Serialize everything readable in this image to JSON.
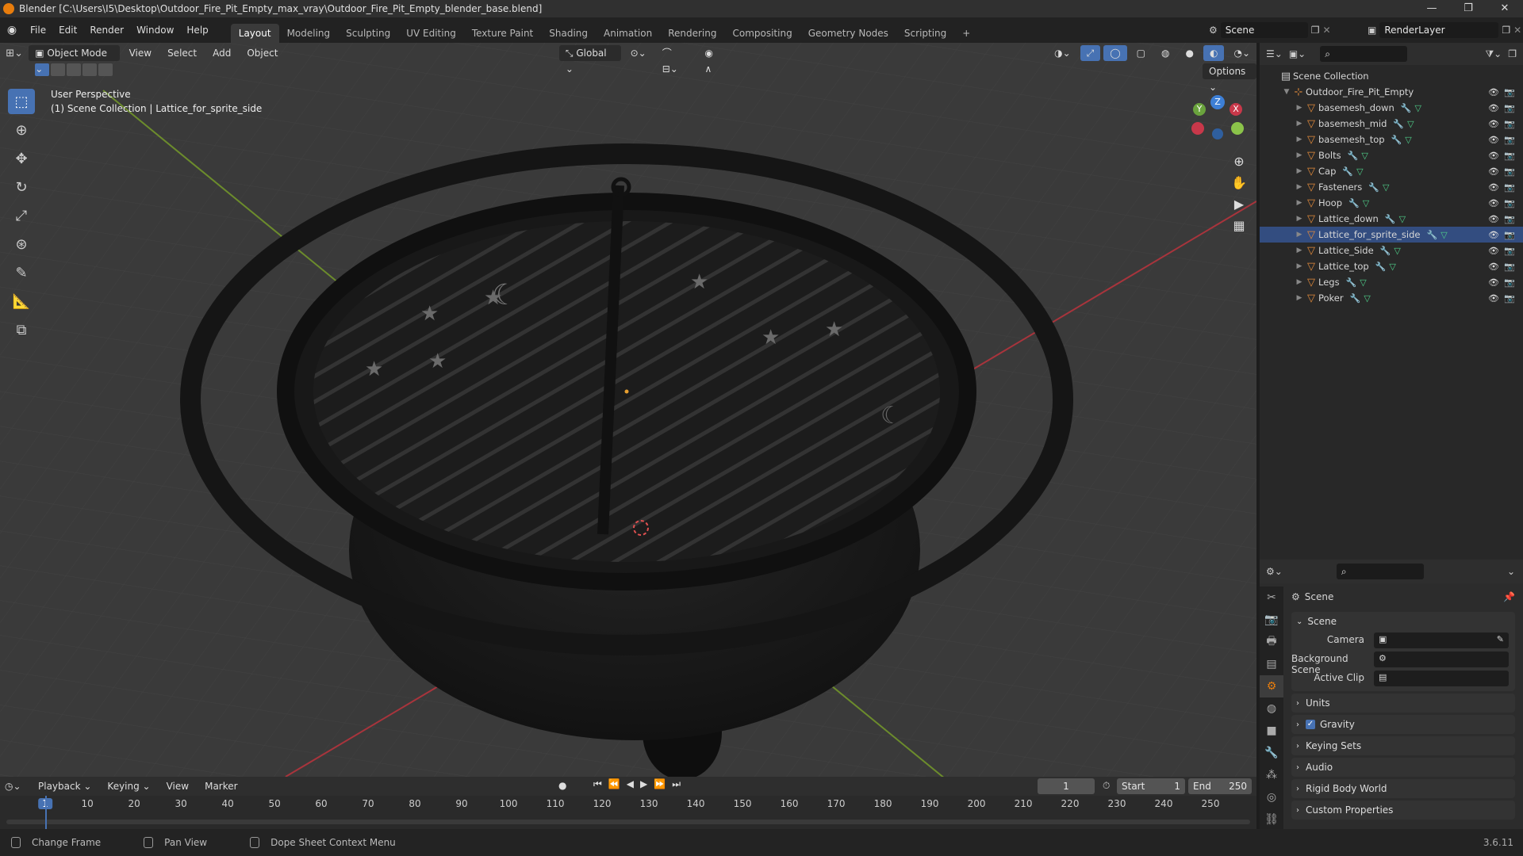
{
  "window": {
    "title": "Blender [C:\\Users\\I5\\Desktop\\Outdoor_Fire_Pit_Empty_max_vray\\Outdoor_Fire_Pit_Empty_blender_base.blend]",
    "minimize": "—",
    "restore": "❐",
    "close": "✕"
  },
  "menubar": {
    "menus": [
      "File",
      "Edit",
      "Render",
      "Window",
      "Help"
    ],
    "workspaces": [
      "Layout",
      "Modeling",
      "Sculpting",
      "UV Editing",
      "Texture Paint",
      "Shading",
      "Animation",
      "Rendering",
      "Compositing",
      "Geometry Nodes",
      "Scripting"
    ],
    "active_workspace": "Layout",
    "add_tab": "+",
    "scene_name": "Scene",
    "view_layer": "RenderLayer"
  },
  "viewport_header": {
    "mode": "Object Mode",
    "menus": [
      "View",
      "Select",
      "Add",
      "Object"
    ],
    "orientation": "Global",
    "options": "Options"
  },
  "viewport": {
    "perspective": "User Perspective",
    "collection_info": "(1) Scene Collection | Lattice_for_sprite_side",
    "gizmo": {
      "x": "X",
      "y": "Y",
      "z": "Z"
    }
  },
  "outliner": {
    "root": "Scene Collection",
    "collection": "Outdoor_Fire_Pit_Empty",
    "items": [
      "basemesh_down",
      "basemesh_mid",
      "basemesh_top",
      "Bolts",
      "Cap",
      "Fasteners",
      "Hoop",
      "Lattice_down",
      "Lattice_for_sprite_side",
      "Lattice_Side",
      "Lattice_top",
      "Legs",
      "Poker"
    ],
    "selected": "Lattice_for_sprite_side"
  },
  "properties": {
    "context": "Scene",
    "panel": "Scene",
    "camera_label": "Camera",
    "background_label": "Background Scene",
    "clip_label": "Active Clip",
    "subpanels": [
      "Units",
      "Gravity",
      "Keying Sets",
      "Audio",
      "Rigid Body World",
      "Custom Properties"
    ],
    "gravity_checked": true
  },
  "timeline": {
    "menus": [
      "Playback",
      "Keying",
      "View",
      "Marker"
    ],
    "current_frame": "1",
    "start_label": "Start",
    "start": "1",
    "end_label": "End",
    "end": "250",
    "ticks": [
      "1",
      "10",
      "20",
      "30",
      "40",
      "50",
      "60",
      "70",
      "80",
      "90",
      "100",
      "110",
      "120",
      "130",
      "140",
      "150",
      "160",
      "170",
      "180",
      "190",
      "200",
      "210",
      "220",
      "230",
      "240",
      "250"
    ]
  },
  "statusbar": {
    "items": [
      "Change Frame",
      "Pan View",
      "Dope Sheet Context Menu"
    ],
    "version": "3.6.11"
  },
  "colors": {
    "accent": "#4772b3",
    "blender_orange": "#e87d0d",
    "selected_row": "#334d80",
    "x_axis": "#d8434c",
    "y_axis": "#8bc34a"
  }
}
